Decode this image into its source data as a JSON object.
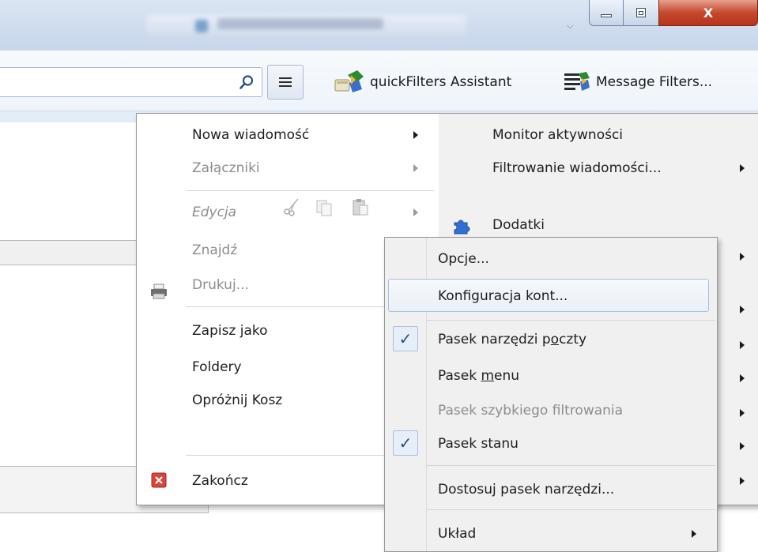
{
  "window": {
    "tab_title": "GMR.IS - Find Google",
    "min_icon": "minimize-icon",
    "max_icon": "restore-icon",
    "close_label": "X"
  },
  "toolbar": {
    "search_placeholder": "",
    "search_icon": "search-icon",
    "menu_icon": "hamburger-menu-icon",
    "quickfilters_label": "quickFilters Assistant",
    "message_filters_label": "Message Filters..."
  },
  "app_menu": {
    "left": [
      {
        "label": "Nowa wiadomość",
        "disabled": false,
        "submenu": true
      },
      {
        "label": "Załączniki",
        "disabled": true,
        "submenu": true
      },
      {
        "label": "Edycja",
        "disabled": true,
        "submenu": true
      },
      {
        "label": "Znajdź",
        "disabled": true,
        "submenu": false
      },
      {
        "label": "Drukuj...",
        "disabled": true,
        "submenu": false
      },
      {
        "label": "Zapisz jako",
        "disabled": false,
        "submenu": false
      },
      {
        "label": "Foldery",
        "disabled": false,
        "submenu": false
      },
      {
        "label": "Opróżnij Kosz",
        "disabled": false,
        "submenu": false
      },
      {
        "label": "Zakończ",
        "disabled": false,
        "submenu": false
      }
    ],
    "right": [
      {
        "label": "Monitor aktywności"
      },
      {
        "label": "Filtrowanie wiadomości..."
      },
      {
        "label": "Dodatki"
      }
    ]
  },
  "submenu": {
    "items": [
      {
        "label": "Opcje..."
      },
      {
        "label": "Konfiguracja kont..."
      },
      {
        "label_pre": "Pasek narzędzi p",
        "label_u": "o",
        "label_post": "czty",
        "checked": true
      },
      {
        "label_pre": "Pasek ",
        "label_u": "m",
        "label_post": "enu",
        "checked": false
      },
      {
        "label": "Pasek szybkiego filtrowania",
        "disabled": true
      },
      {
        "label": "Pasek stanu",
        "checked": true
      },
      {
        "label": "Dostosuj pasek narzędzi..."
      },
      {
        "label": "Układ"
      }
    ],
    "check_glyph": "✓"
  }
}
